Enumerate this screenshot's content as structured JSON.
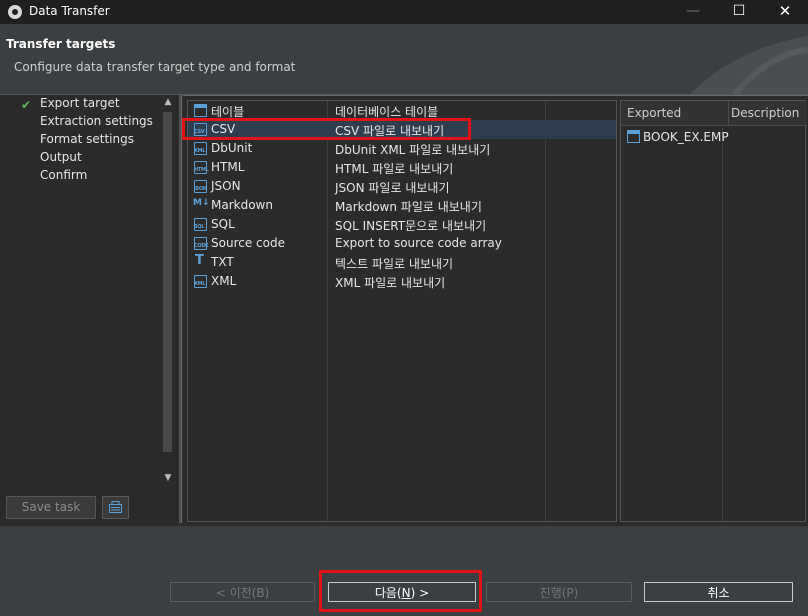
{
  "window": {
    "title": "Data Transfer"
  },
  "header": {
    "title": "Transfer targets",
    "subtitle": "Configure data transfer target type and format"
  },
  "steps": [
    {
      "label": "Export target",
      "done": true
    },
    {
      "label": "Extraction settings",
      "done": false
    },
    {
      "label": "Format settings",
      "done": false
    },
    {
      "label": "Output",
      "done": false
    },
    {
      "label": "Confirm",
      "done": false
    }
  ],
  "left_actions": {
    "save_task": "Save task"
  },
  "formats": [
    {
      "name": "테이블",
      "description": "데이터베이스 테이블",
      "icon": "table-icon"
    },
    {
      "name": "CSV",
      "description": "CSV 파일로 내보내기",
      "icon": "csv-file-icon"
    },
    {
      "name": "DbUnit",
      "description": "DbUnit XML 파일로 내보내기",
      "icon": "xml-file-icon"
    },
    {
      "name": "HTML",
      "description": "HTML 파일로 내보내기",
      "icon": "html-file-icon"
    },
    {
      "name": "JSON",
      "description": "JSON 파일로 내보내기",
      "icon": "json-file-icon"
    },
    {
      "name": "Markdown",
      "description": "Markdown 파일로 내보내기",
      "icon": "markdown-icon"
    },
    {
      "name": "SQL",
      "description": "SQL INSERT문으로 내보내기",
      "icon": "sql-file-icon"
    },
    {
      "name": "Source code",
      "description": "Export to source code array",
      "icon": "code-file-icon"
    },
    {
      "name": "TXT",
      "description": "텍스트 파일로 내보내기",
      "icon": "text-icon"
    },
    {
      "name": "XML",
      "description": "XML 파일로 내보내기",
      "icon": "xml-file-icon"
    }
  ],
  "selected_format": "CSV",
  "exported": {
    "col_exported": "Exported",
    "col_description": "Description",
    "items": [
      {
        "name": "BOOK_EX.EMP",
        "icon": "table-icon"
      }
    ]
  },
  "buttons": {
    "prev": "< 이전(B)",
    "next_pre": "다음(",
    "next_key": "N",
    "next_post": ") >",
    "proceed": "진행(P)",
    "cancel": "취소"
  },
  "colors": {
    "highlight": "#e01414",
    "selected_row": "#2f3e4e",
    "check": "#5fb85f",
    "icon_blue": "#5aa0d8"
  }
}
